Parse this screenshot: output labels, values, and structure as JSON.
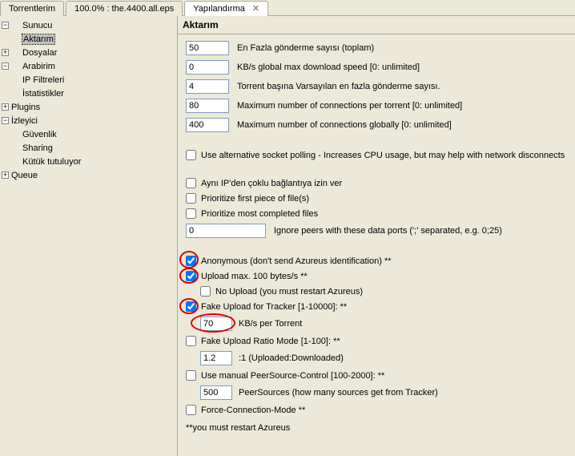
{
  "tabs": {
    "torrents": "Torrentlerim",
    "file": "100.0% : the.4400.all.eps",
    "config": "Yapılandırma"
  },
  "sidebar": {
    "items": [
      {
        "label": "Sunucu",
        "depth": 1,
        "expand": "-"
      },
      {
        "label": "Aktarım",
        "depth": 1,
        "selected": true
      },
      {
        "label": "Dosyalar",
        "depth": 1,
        "expand": "+"
      },
      {
        "label": "Arabirim",
        "depth": 1,
        "expand": "-"
      },
      {
        "label": "IP Filtreleri",
        "depth": 1
      },
      {
        "label": "İstatistikler",
        "depth": 1
      },
      {
        "label": "Plugins",
        "depth": 0,
        "expand": "+"
      },
      {
        "label": "İzleyici",
        "depth": 0,
        "expand": "-"
      },
      {
        "label": "Güvenlik",
        "depth": 1
      },
      {
        "label": "Sharing",
        "depth": 1
      },
      {
        "label": "Kütük tutuluyor",
        "depth": 1
      },
      {
        "label": "Queue",
        "depth": 0,
        "expand": "+"
      }
    ]
  },
  "section": {
    "title": "Aktarım"
  },
  "fields": {
    "maxUpSlots": {
      "value": "50",
      "label": "En Fazla gönderme sayısı (toplam)"
    },
    "maxDown": {
      "value": "0",
      "label": "KB/s global max download speed [0: unlimited]"
    },
    "defaultUpPerTorrent": {
      "value": "4",
      "label": "Torrent başına Varsayılan en fazla gönderme sayısı."
    },
    "maxConnPerTorrent": {
      "value": "80",
      "label": "Maximum number of connections per torrent [0: unlimited]"
    },
    "maxConnGlobal": {
      "value": "400",
      "label": "Maximum number of connections globally [0: unlimited]"
    }
  },
  "checks": {
    "altSocket": {
      "checked": false,
      "label": "Use alternative socket polling - Increases CPU usage, but may help with network disconnects"
    },
    "sameIp": {
      "checked": false,
      "label": "Aynı IP'den çoklu bağlantıya izin ver"
    },
    "prioFirst": {
      "checked": false,
      "label": "Prioritize first piece of file(s)"
    },
    "prioMost": {
      "checked": false,
      "label": "Prioritize most completed files"
    },
    "ignorePorts": {
      "value": "0",
      "label": "Ignore peers with these data ports (';' separated, e.g. 0;25)"
    },
    "anonymous": {
      "checked": true,
      "label": "Anonymous (don't send Azureus identification) **"
    },
    "uploadMax": {
      "checked": true,
      "label": "Upload max. 100 bytes/s **"
    },
    "noUpload": {
      "checked": false,
      "label": "No Upload (you must restart Azureus)"
    },
    "fakeUpload": {
      "checked": true,
      "label": "Fake Upload for Tracker [1-10000]: **"
    },
    "fakeUploadVal": {
      "value": "70",
      "label": "KB/s per Torrent"
    },
    "fakeRatio": {
      "checked": false,
      "label": "Fake Upload Ratio Mode [1-100]: **"
    },
    "fakeRatioVal": {
      "value": "1.2",
      "label": ":1 (Uploaded:Downloaded)"
    },
    "manualPeer": {
      "checked": false,
      "label": "Use manual PeerSource-Control [100-2000]: **"
    },
    "manualPeerVal": {
      "value": "500",
      "label": "PeerSources (how many sources get from Tracker)"
    },
    "forceConn": {
      "checked": false,
      "label": "Force-Connection-Mode **"
    }
  },
  "note": "**you must restart Azureus"
}
